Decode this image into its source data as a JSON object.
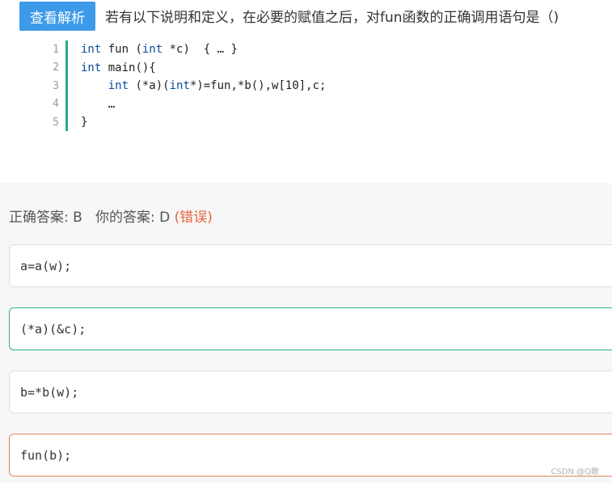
{
  "header": {
    "analysis_button": "查看解析",
    "question": "若有以下说明和定义，在必要的赋值之后，对fun函数的正确调用语句是（)"
  },
  "code": {
    "line_numbers": [
      "1",
      "2",
      "3",
      "4",
      "5"
    ],
    "lines": [
      {
        "kw1": "int",
        "rest1": " fun (",
        "kw2": "int",
        "rest2": " *c)  { … }"
      },
      {
        "kw1": "int",
        "rest1": " main(){",
        "kw2": "",
        "rest2": ""
      },
      {
        "kw1": "int",
        "rest1": " (*a)(",
        "kw2": "int",
        "rest2": "*)=fun,*b(),w[10],c;"
      },
      {
        "kw1": "",
        "rest1": "…",
        "kw2": "",
        "rest2": ""
      },
      {
        "kw1": "",
        "rest1": "}",
        "kw2": "",
        "rest2": ""
      }
    ]
  },
  "answer": {
    "correct_label": "正确答案: B",
    "your_label": "你的答案: D",
    "result": "(错误)"
  },
  "options": [
    {
      "text": "a=a(w);",
      "state": "normal"
    },
    {
      "text": "(*a)(&c);",
      "state": "correct"
    },
    {
      "text": "b=*b(w);",
      "state": "normal"
    },
    {
      "text": "fun(b);",
      "state": "wrong"
    }
  ],
  "watermark": "CSDN @Q敢",
  "colors": {
    "accent": "#3d9ae8",
    "correct": "#2fae8f",
    "wrong": "#e8623e"
  }
}
